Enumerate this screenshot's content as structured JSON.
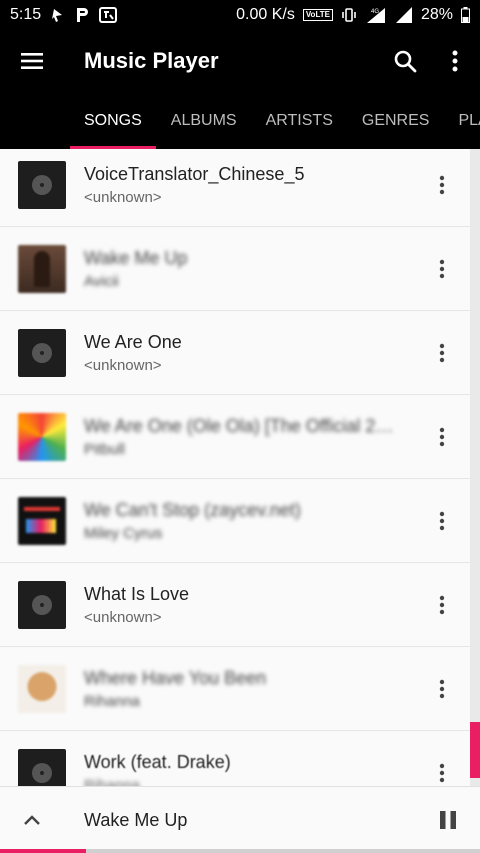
{
  "status_bar": {
    "time": "5:15",
    "net_speed": "0.00 K/s",
    "volte": "VoLTE",
    "signal_label": "4G",
    "battery": "28%"
  },
  "toolbar": {
    "title": "Music Player",
    "menu_icon": "menu-icon",
    "search_icon": "search-icon",
    "more_icon": "more-vert-icon"
  },
  "tabs": [
    "SONGS",
    "ALBUMS",
    "ARTISTS",
    "GENRES",
    "PLAY"
  ],
  "songs": [
    {
      "title": "VoiceTranslator_Chinese_5",
      "artist": "<unknown>"
    },
    {
      "title": "Wake Me Up",
      "artist": "Avicii"
    },
    {
      "title": "We Are One",
      "artist": "<unknown>"
    },
    {
      "title": "We Are One (Ole Ola) [The Official 20...",
      "artist": "Pitbull"
    },
    {
      "title": "We Can't Stop (zaycev.net)",
      "artist": "Miley Cyrus"
    },
    {
      "title": "What Is Love",
      "artist": "<unknown>"
    },
    {
      "title": "Where Have You Been",
      "artist": "Rihanna"
    },
    {
      "title": "Work (feat. Drake)",
      "artist": "Rihanna"
    }
  ],
  "now_playing": {
    "title": "Wake Me Up",
    "progress": 0.18
  },
  "colors": {
    "accent": "#e91e63",
    "bar": "#000000",
    "background": "#fafafa"
  }
}
